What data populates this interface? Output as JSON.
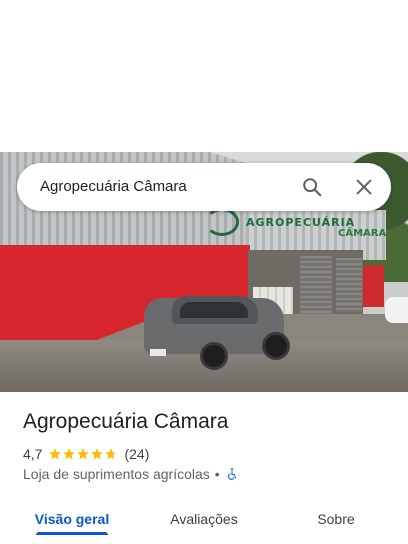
{
  "search": {
    "query": "Agropecuária Câmara",
    "search_icon": "search-icon",
    "close_icon": "close-icon"
  },
  "photo": {
    "sign_text": "AGROPECUÁRIA",
    "sign_text2": "CÂMARA"
  },
  "place": {
    "name": "Agropecuária Câmara",
    "rating": "4,7",
    "stars": 4.7,
    "reviews": "(24)",
    "category": "Loja de suprimentos agrícolas",
    "separator": "•",
    "accessibility_icon": "wheelchair-icon"
  },
  "tabs": [
    {
      "label": "Visão geral",
      "active": true
    },
    {
      "label": "Avaliações",
      "active": false
    },
    {
      "label": "Sobre",
      "active": false
    }
  ],
  "colors": {
    "accent": "#0b57d0",
    "star": "#fbbc04",
    "accessibility": "#1a73e8"
  }
}
